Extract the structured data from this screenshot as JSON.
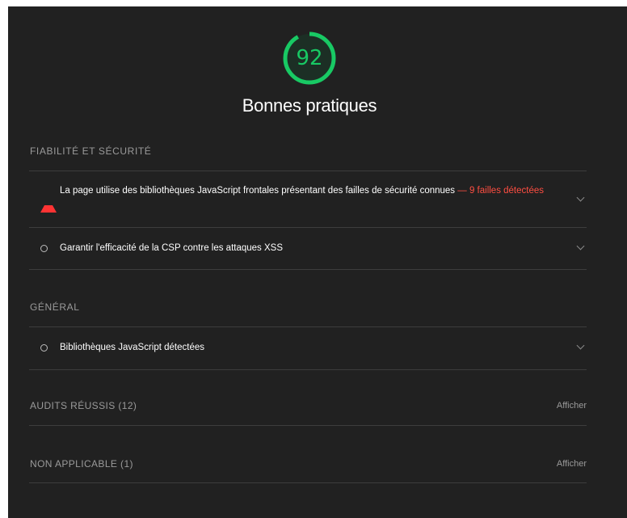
{
  "category": {
    "score": "92",
    "score_fraction": 0.92,
    "title": "Bonnes pratiques",
    "colors": {
      "pass": "#18c964",
      "fail": "#ff4e42",
      "panel_bg": "#212121"
    }
  },
  "groups": [
    {
      "header": "FIABILITÉ ET SÉCURITÉ",
      "audits": [
        {
          "status_icon": "fail-triangle-icon",
          "text": "La page utilise des bibliothèques JavaScript frontales présentant des failles de sécurité connues",
          "display_value": " — 9 failles détectées"
        },
        {
          "status_icon": "info-circle-icon",
          "text": "Garantir l'efficacité de la CSP contre les attaques XSS",
          "display_value": ""
        }
      ]
    },
    {
      "header": "GÉNÉRAL",
      "audits": [
        {
          "status_icon": "info-circle-icon",
          "text": "Bibliothèques JavaScript détectées",
          "display_value": ""
        }
      ]
    }
  ],
  "passed": {
    "label": "AUDITS RÉUSSIS (12)",
    "action": "Afficher"
  },
  "not_applicable": {
    "label": "NON APPLICABLE (1)",
    "action": "Afficher"
  }
}
